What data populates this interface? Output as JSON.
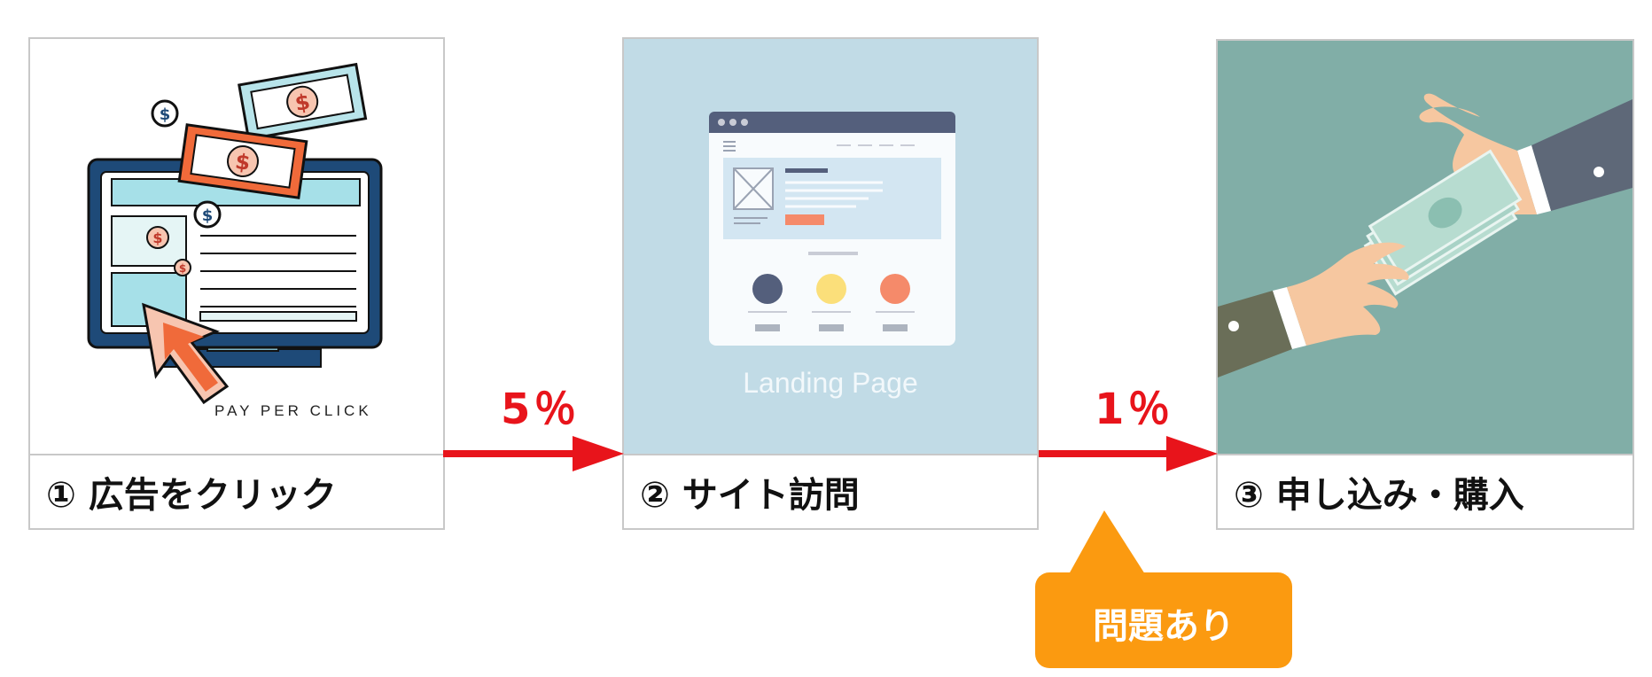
{
  "steps": [
    {
      "label": "① 広告をクリック",
      "image_caption": "PAY PER CLICK"
    },
    {
      "label": "② サイト訪問",
      "image_caption": "Landing Page"
    },
    {
      "label": "③ 申し込み・購入"
    }
  ],
  "conversions": [
    {
      "value": "5％"
    },
    {
      "value": "1％"
    }
  ],
  "callout": {
    "text": "問題あり",
    "color": "#fb9a10"
  },
  "colors": {
    "arrow": "#e8141b",
    "accent": "#fb9a10"
  }
}
